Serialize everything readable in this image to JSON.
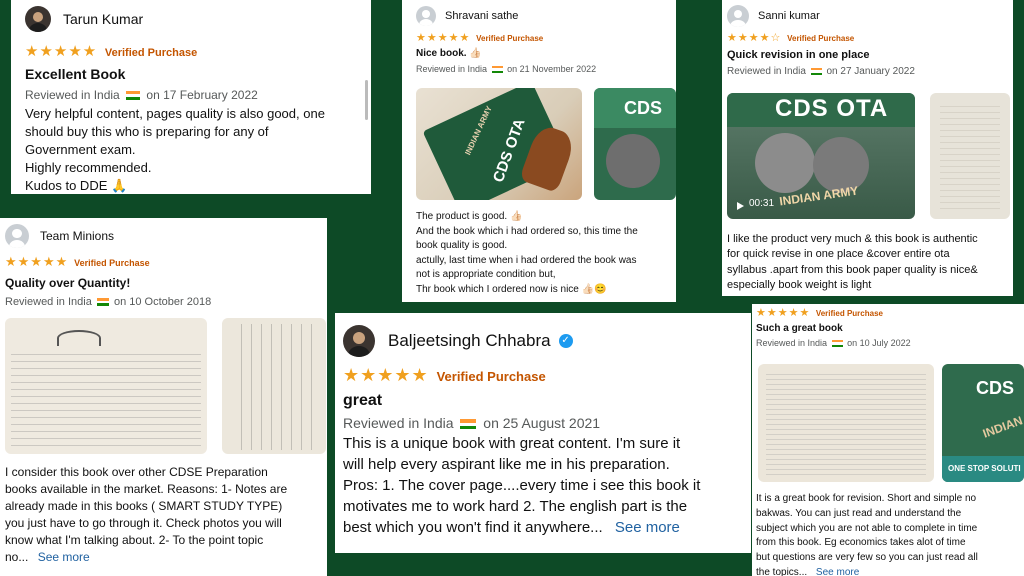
{
  "colors": {
    "background": "#0d4a26",
    "star": "#f0a01f",
    "verified": "#c45500",
    "link": "#2162a1"
  },
  "reviews": [
    {
      "name": "Tarun Kumar",
      "stars": "★★★★★",
      "verified": "Verified Purchase",
      "title": "Excellent Book",
      "reviewed": "Reviewed in India",
      "date": "on 17 February 2022",
      "body": [
        "Very helpful content, pages quality is also good, one",
        "should buy this who is preparing for any of",
        "Government exam.",
        "Highly recommended.",
        "Kudos to DDE 🙏"
      ]
    },
    {
      "name": "Shravani sathe",
      "stars": "★★★★★",
      "verified": "Verified Purchase",
      "title": "Nice book. 👍🏻",
      "reviewed": "Reviewed in India",
      "date": "on 21 November 2022",
      "img_text": [
        "CDS OTA",
        "INDIAN ARMY",
        "CDS"
      ],
      "body": [
        "The product is good. 👍🏻",
        "And the book which i had ordered so, this time the",
        "book quality is good.",
        "actully, last time when i had ordered the book was",
        "not is appropriate condition but,",
        "Thr book which I ordered now is nice 👍🏻😊"
      ]
    },
    {
      "name": "Sanni kumar",
      "stars": "★★★★☆",
      "verified": "Verified Purchase",
      "title": "Quick revision in one place",
      "reviewed": "Reviewed in India",
      "date": "on 27 January 2022",
      "video_time": "00:31",
      "img_text": [
        "CDS OTA",
        "INDIAN ARMY"
      ],
      "body": [
        "I like the product very much & this book is authentic",
        "for quick revise in one place &cover entire ota",
        "syllabus .apart from this book paper quality is nice&",
        "especially book weight is light"
      ]
    },
    {
      "name": "Team Minions",
      "stars": "★★★★★",
      "verified": "Verified Purchase",
      "title": "Quality over Quantity!",
      "reviewed": "Reviewed in India",
      "date": "on 10 October 2018",
      "body": [
        "I consider this book over other CDSE Preparation",
        "books available in the market. Reasons: 1- Notes are",
        "already made in this books ( SMART STUDY TYPE)",
        "you just have to go through it. Check photos you will",
        "know what I'm talking about. 2- To the point topic",
        "no..."
      ],
      "see_more": "See more"
    },
    {
      "name": "Baljeetsingh Chhabra",
      "stars": "★★★★★",
      "verified": "Verified Purchase",
      "title": "great",
      "reviewed": "Reviewed in India",
      "date": "on 25 August 2021",
      "body": [
        "This is a unique book with great content. I'm sure it",
        "will help every aspirant like me in his preparation.",
        "Pros: 1. The cover page....every time i see this book it",
        "motivates me to work hard 2. The english part is the",
        "best which you won't find it anywhere..."
      ],
      "see_more": "See more"
    },
    {
      "stars": "★★★★★",
      "verified": "Verified Purchase",
      "title": "Such a great book",
      "reviewed": "Reviewed in India",
      "date": "on 10 July 2022",
      "img_text": [
        "CDS",
        "INDIAN",
        "ONE STOP SOLUTI"
      ],
      "body": [
        "It is a great book for revision. Short and simple no",
        "bakwas. You can just read and understand the",
        "subject which you are not able to complete in time",
        "from this book. Eg economics takes alot of time",
        "but questions are very few so you can just read all",
        "the topics..."
      ],
      "see_more": "See more"
    }
  ]
}
